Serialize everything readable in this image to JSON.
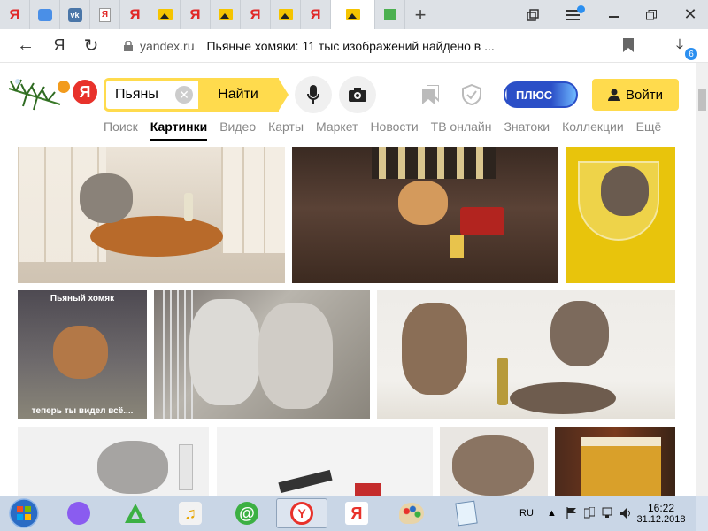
{
  "browser": {
    "tabs": [
      {
        "icon": "yandex-icon",
        "label": "Я"
      },
      {
        "icon": "chat-icon",
        "label": ""
      },
      {
        "icon": "vk-icon",
        "label": "vk"
      },
      {
        "icon": "doc-icon",
        "label": "Я"
      },
      {
        "icon": "yandex-icon",
        "label": "Я"
      },
      {
        "icon": "picture-icon",
        "label": ""
      },
      {
        "icon": "yandex-icon",
        "label": "Я"
      },
      {
        "icon": "picture-icon",
        "label": ""
      },
      {
        "icon": "yandex-icon",
        "label": "Я"
      },
      {
        "icon": "picture-icon",
        "label": ""
      },
      {
        "icon": "yandex-icon",
        "label": "Я"
      },
      {
        "icon": "picture-icon",
        "label": ""
      },
      {
        "icon": "green-icon",
        "label": ""
      }
    ],
    "new_tab": "+",
    "address": {
      "domain": "yandex.ru",
      "title": "Пьяные хомяки: 11 тыс изображений найдено в ..."
    },
    "downloads_badge": "6"
  },
  "header": {
    "logo": "Я",
    "search_value": "Пьяны",
    "find_label": "Найти",
    "plus_label": "ПЛЮС",
    "login_label": "Войти",
    "service_tabs": [
      "Поиск",
      "Картинки",
      "Видео",
      "Карты",
      "Маркет",
      "Новости",
      "ТВ онлайн",
      "Знатоки",
      "Коллекции",
      "Ещё"
    ],
    "active_tab": "Картинки"
  },
  "images": {
    "meme_top": "Пьяный хомяк",
    "meme_bottom": "теперь ты видел всё...."
  },
  "taskbar": {
    "lang": "RU",
    "time": "16:22",
    "date": "31.12.2018"
  }
}
